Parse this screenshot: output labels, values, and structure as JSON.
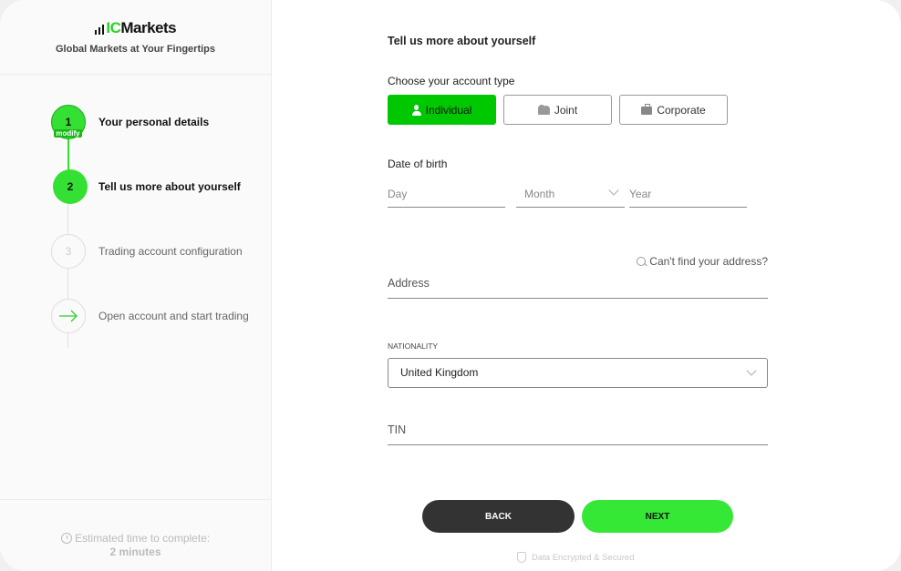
{
  "brand": {
    "logo_ic": "IC",
    "logo_markets": "Markets",
    "tagline": "Global Markets at Your Fingertips",
    "accent_color": "#33e033"
  },
  "steps": [
    {
      "number": "1",
      "label": "Your personal details",
      "state": "done",
      "badge": "modify"
    },
    {
      "number": "2",
      "label": "Tell us more about yourself",
      "state": "active"
    },
    {
      "number": "3",
      "label": "Trading account configuration",
      "state": "todo"
    },
    {
      "number": "",
      "icon": "arrow-right-icon",
      "label": "Open account and start trading",
      "state": "final"
    }
  ],
  "sidebar_footer": {
    "icon": "clock-icon",
    "estimated_label": "Estimated time to complete:",
    "estimated_value": "2 minutes"
  },
  "form": {
    "title": "Tell us more about yourself",
    "account_type": {
      "label": "Choose your account type",
      "options": [
        {
          "label": "Individual",
          "icon": "person-icon",
          "selected": true
        },
        {
          "label": "Joint",
          "icon": "people-icon",
          "selected": false
        },
        {
          "label": "Corporate",
          "icon": "briefcase-icon",
          "selected": false
        }
      ]
    },
    "dob": {
      "label": "Date of birth",
      "day_placeholder": "Day",
      "month_placeholder": "Month",
      "year_placeholder": "Year"
    },
    "address": {
      "cant_find_link": "Can't find your address?",
      "placeholder": "Address"
    },
    "nationality": {
      "label": "NATIONALITY",
      "selected": "United Kingdom"
    },
    "tin": {
      "placeholder": "TIN"
    },
    "buttons": {
      "back": "BACK",
      "next": "NEXT"
    },
    "security_note": "Data Encrypted & Secured"
  }
}
